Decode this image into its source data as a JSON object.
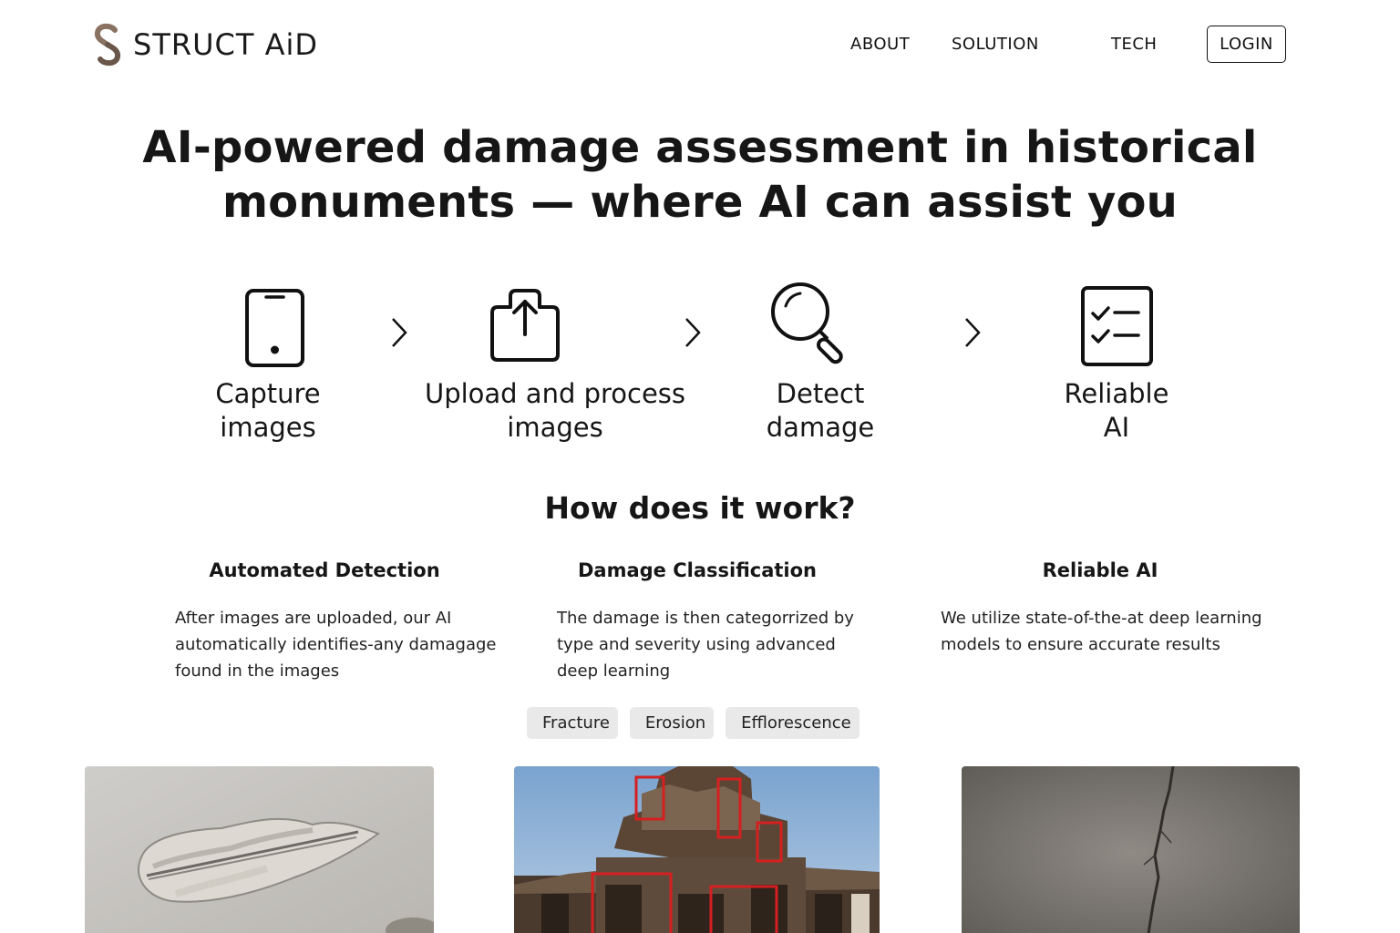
{
  "brand": {
    "name": "STRUCT AiD",
    "logo_icon": "s-chain-icon",
    "accent": "#8a7262"
  },
  "nav": {
    "about": "ABOUT",
    "solution": "SOLUTION",
    "tech": "TECH",
    "login": "LOGIN"
  },
  "hero": {
    "line1": "AI-powered damage assessment in historical",
    "line2": "monuments — where AI can assist you"
  },
  "steps": [
    {
      "icon": "smartphone-icon",
      "line1": "Capture",
      "line2": "images"
    },
    {
      "icon": "upload-icon",
      "line1": "Upload and process",
      "line2": "images"
    },
    {
      "icon": "magnifier-icon",
      "line1": "Detect",
      "line2": "damage"
    },
    {
      "icon": "checklist-icon",
      "line1": "Reliable",
      "line2": "AI"
    }
  ],
  "how": {
    "title": "How does it work?",
    "features": [
      {
        "title": "Automated Detection",
        "lines": [
          "After images are uploaded, our AI",
          "automatically identifies-any damagage",
          "found in the images"
        ]
      },
      {
        "title": "Damage Classification",
        "lines": [
          "The damage is then categorrized by",
          "type and severity using advanced",
          "deep learning"
        ]
      },
      {
        "title": "Reliable AI",
        "lines": [
          "We utilize state-of-the-at deep learning",
          "models to ensure accurate results"
        ]
      }
    ]
  },
  "tags": [
    "Fracture",
    "Erosion",
    "Efflorescence"
  ],
  "colors": {
    "detection_box": "#d42020",
    "tag_bg": "#e9e9e9"
  }
}
